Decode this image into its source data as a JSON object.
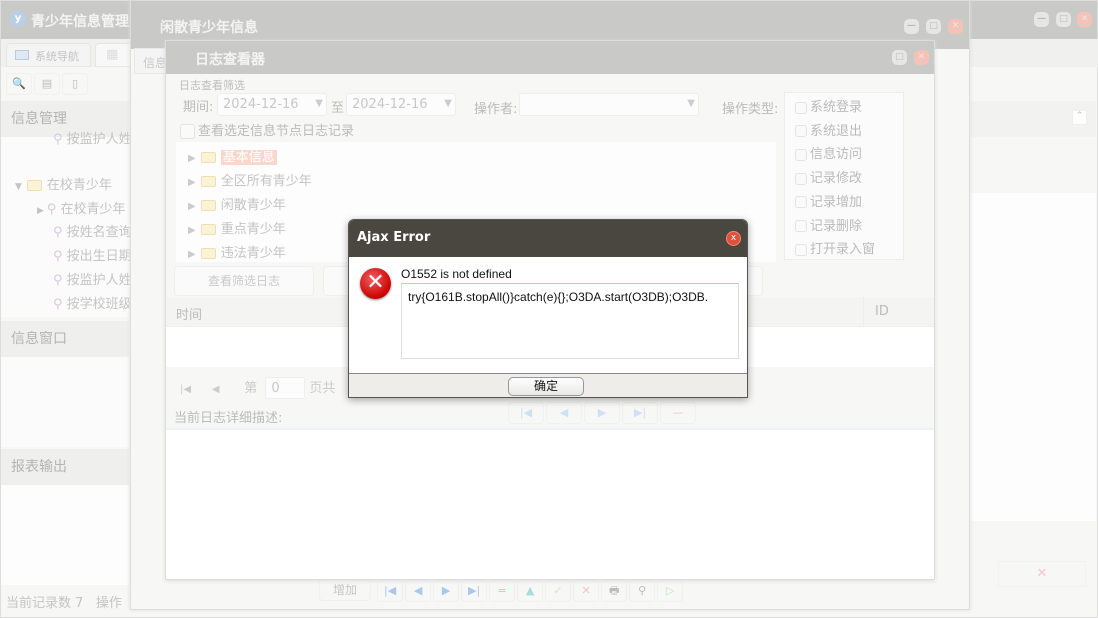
{
  "main": {
    "title": "青少年信息管理系",
    "tabs": [
      "系统导航",
      ""
    ],
    "sidebar": {
      "section1": "信息管理",
      "section2": "信息窗口",
      "section3": "报表输出",
      "tree": [
        {
          "label": "按监护人姓",
          "level": 2
        },
        {
          "label": "在校青少年",
          "level": 1
        },
        {
          "label": "在校青少年",
          "level": 2
        },
        {
          "label": "按姓名查询",
          "level": 2
        },
        {
          "label": "按出生日期",
          "level": 2
        },
        {
          "label": "按监护人姓",
          "level": 2
        },
        {
          "label": "按学校班级",
          "level": 2
        }
      ]
    },
    "status": {
      "record_count": "当前记录数 7",
      "op": "操作"
    }
  },
  "youth_window": {
    "title": "闲散青少年信息",
    "tab": "信息",
    "toolbar": {
      "add": "增加"
    }
  },
  "log_viewer": {
    "title": "日志查看器",
    "filter_group": "日志查看筛选",
    "period_label": "期间:",
    "date_from": "2024-12-16",
    "to_label": "至",
    "date_to": "2024-12-16",
    "operator_label": "操作者:",
    "operator_value": "",
    "optype_label": "操作类型:",
    "optypes": [
      "系统登录",
      "系统退出",
      "信息访问",
      "记录修改",
      "记录增加",
      "记录删除",
      "打开录入窗"
    ],
    "node_checkbox": "查看选定信息节点日志记录",
    "tree": [
      "基本信息",
      "全区所有青少年",
      "闲散青少年",
      "重点青少年",
      "违法青少年"
    ],
    "view_button": "查看筛选日志",
    "columns": {
      "time": "时间",
      "id": "ID"
    },
    "pager": {
      "page_label": "第",
      "page_value": "0",
      "total_label": "页共"
    },
    "detail_label": "当前日志详细描述:"
  },
  "dialog": {
    "title": "Ajax Error",
    "message": "O1552 is not defined",
    "detail": "try{O161B.stopAll()}catch(e){};O3DA.start(O3DB);O3DB.",
    "ok": "确定"
  }
}
